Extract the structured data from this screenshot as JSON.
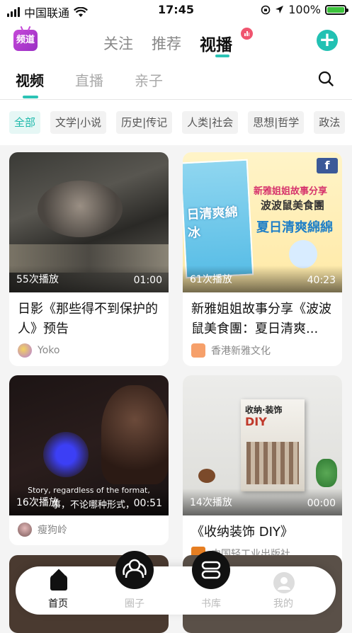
{
  "status_bar": {
    "carrier": "中国联通",
    "time": "17:45",
    "battery": "100%"
  },
  "top_nav": {
    "channel_label": "频道",
    "tabs": [
      "关注",
      "推荐",
      "视播"
    ],
    "active_tab": "视播"
  },
  "sub_tabs": {
    "items": [
      "视频",
      "直播",
      "亲子"
    ],
    "active": "视频"
  },
  "categories": [
    "全部",
    "文学|小说",
    "历史|传记",
    "人类|社会",
    "思想|哲学",
    "政法"
  ],
  "cards": [
    {
      "plays": "55次播放",
      "duration": "01:00",
      "title": "日影《那些得不到保护的人》预告",
      "author": "Yoko"
    },
    {
      "plays": "61次播放",
      "duration": "40:23",
      "title": "新雅姐姐故事分享《波波鼠美食團：夏日清爽...",
      "author": "香港新雅文化"
    },
    {
      "plays": "16次播放",
      "duration": "00:51",
      "title": "",
      "author": "瘦狗岭",
      "subtitle_line1": "Story, regardless of the format,",
      "subtitle_line2": "事，不论哪种形式，"
    },
    {
      "plays": "14次播放",
      "duration": "00:00",
      "title": "《收纳装饰 DIY》",
      "author": "中国轻工业出版社"
    }
  ],
  "thumb_text": {
    "poster_header": "新雅姐姐故事分享",
    "poster_sub": "波波鼠美食團",
    "poster_main": "夏日清爽綿綿",
    "poster_left": "日清爽綿冰",
    "book_title": "收纳·装饰",
    "book_diy": "DIY"
  },
  "bottom_nav": [
    {
      "label": "首页",
      "active": true
    },
    {
      "label": "圈子",
      "active": false
    },
    {
      "label": "书库",
      "active": false
    },
    {
      "label": "我的",
      "active": false
    }
  ],
  "colors": {
    "accent": "#22c1b3",
    "live_badge": "#f0556f",
    "channel_badge": "#b43cd0"
  }
}
